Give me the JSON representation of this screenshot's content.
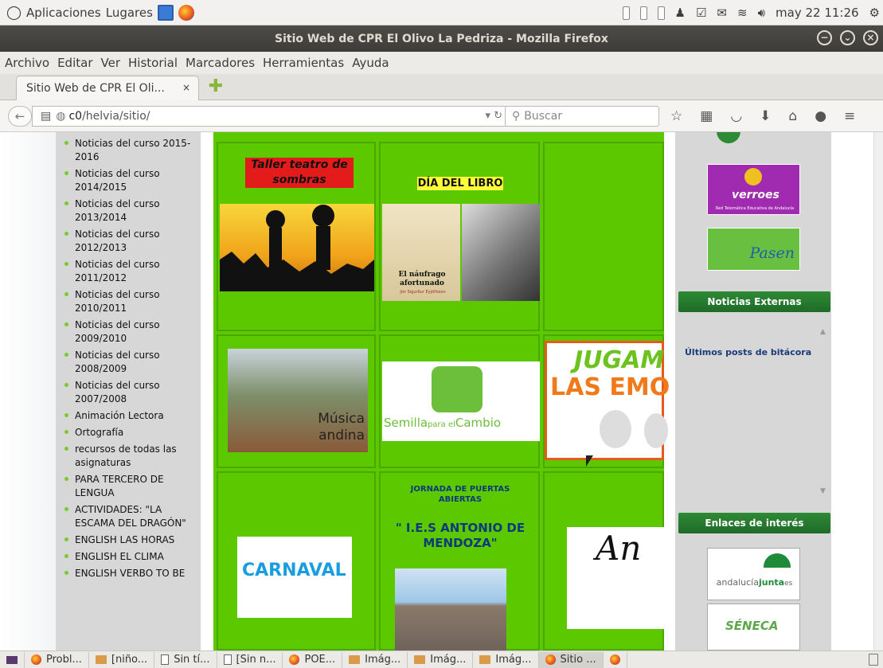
{
  "panel": {
    "apps": "Aplicaciones",
    "places": "Lugares",
    "datetime": "may 22 11:26"
  },
  "window": {
    "title": "Sitio Web de CPR El Olivo La Pedriza - Mozilla Firefox"
  },
  "menu": [
    "Archivo",
    "Editar",
    "Ver",
    "Historial",
    "Marcadores",
    "Herramientas",
    "Ayuda"
  ],
  "tab": {
    "title": "Sitio Web de CPR El Oli...",
    "close": "×"
  },
  "nav": {
    "url_host": "c0",
    "url_path": "/helvia/sitio/",
    "search_placeholder": "Buscar"
  },
  "sidebar": {
    "items": [
      "Noticias del curso 2015-2016",
      "Noticias del curso 2014/2015",
      "Noticias del curso 2013/2014",
      "Noticias del curso 2012/2013",
      "Noticias del curso 2011/2012",
      "Noticias del curso 2010/2011",
      "Noticias del curso 2009/2010",
      "Noticias del curso 2008/2009",
      "Noticias del curso 2007/2008",
      "Animación Lectora",
      "Ortografía",
      "recursos de todas las asignaturas",
      "PARA TERCERO DE LENGUA",
      "ACTIVIDADES: \"LA ESCAMA DEL DRAGÓN\"",
      "ENGLISH LAS HORAS",
      "ENGLISH EL CLIMA",
      "ENGLISH VERBO TO BE"
    ]
  },
  "grid": {
    "teatro": "Taller teatro de sombras",
    "libro": "DÍA DEL LIBRO",
    "book_title": "El náufrago afortunado",
    "book_author": "Jón Sigurður Eyjólfsson",
    "musica": "Música andina",
    "semilla": "Semilla",
    "semilla_para": "para el",
    "semilla_cambio": "Cambio",
    "jugamos_1": "JUGAM",
    "jugamos_2": "LAS EMO",
    "carnaval": "CARNAVAL",
    "jornada": "JORNADA DE PUERTAS ABIERTAS",
    "ies": "\" I.E.S ANTONIO DE MENDOZA\"",
    "andalucia_partial": "An"
  },
  "right": {
    "averroes": "verroes",
    "averroes_sub": "Red Telemática Educativa de Andalucía",
    "pasen": "Pasen",
    "noticias_title": "Noticias Externas",
    "ultimos": "Últimos posts de bitácora",
    "enlaces_title": "Enlaces de interés",
    "junta_a": "andalucía",
    "junta_b": "junta",
    "junta_c": "es",
    "seneca": "SÉNECA"
  },
  "taskbar": [
    "Probl...",
    "[niño...",
    "Sin tí...",
    "[Sin n...",
    "POE...",
    "Imág...",
    "Imág...",
    "Imág...",
    "Sitio ..."
  ]
}
